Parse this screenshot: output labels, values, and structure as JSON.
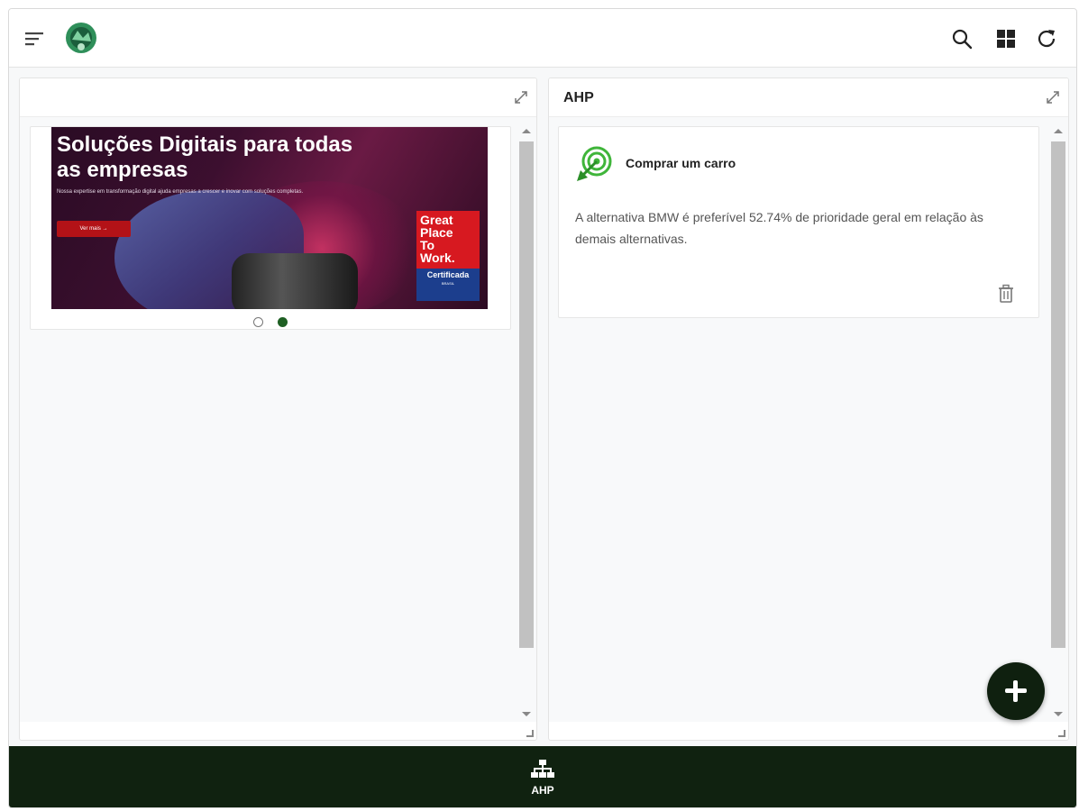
{
  "topbar": {
    "icons": [
      "menu-icon",
      "logo",
      "search-icon",
      "grid-icon",
      "refresh-icon"
    ]
  },
  "left_panel": {
    "title": "",
    "carousel": {
      "banner_title": "Soluções Digitais para todas as empresas",
      "banner_subtitle": "Nossa expertise em transformação digital ajuda empresas a crescer e inovar com soluções completas.",
      "banner_button": "Ver mais →",
      "badge_lines": [
        "Great",
        "Place",
        "To",
        "Work."
      ],
      "badge_certified": "Certificada",
      "badge_sub": "BRASIL",
      "active_slide": 2,
      "slide_count": 2
    }
  },
  "right_panel": {
    "title": "AHP",
    "card": {
      "title": "Comprar um carro",
      "text": "A alternativa BMW é preferível 52.74% de prioridade geral em relação às demais alternativas."
    }
  },
  "bottom_nav": {
    "items": [
      {
        "label": "AHP",
        "icon": "hierarchy-icon"
      }
    ]
  },
  "colors": {
    "bottom_bar": "#102210",
    "fab": "#0f200f",
    "accent_green": "#1e5f23",
    "target_green": "#3fb53a",
    "badge_red": "#d71920",
    "badge_blue": "#1c3e8d"
  }
}
